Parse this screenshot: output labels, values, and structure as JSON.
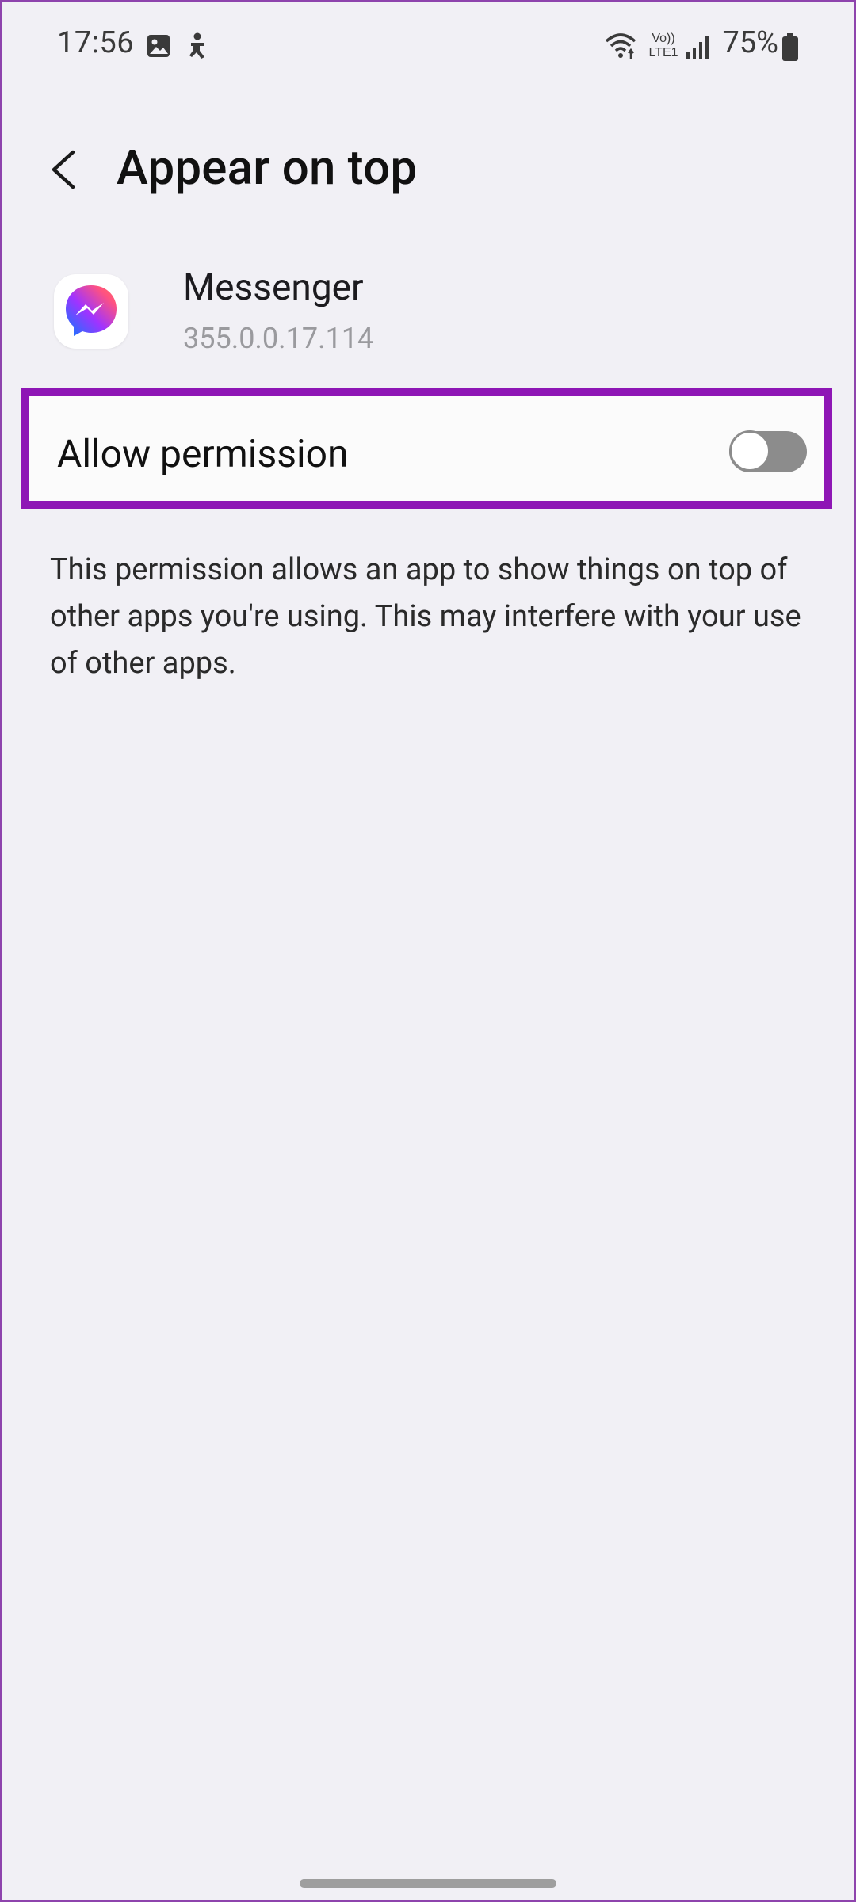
{
  "status_bar": {
    "time": "17:56",
    "battery_percent": "75%",
    "icons": [
      "gallery-icon",
      "accessibility-icon",
      "wifi-icon",
      "volte-lte-icon",
      "signal-icon",
      "battery-icon"
    ],
    "volte_label_top": "Vo))",
    "volte_label_bottom": "LTE1"
  },
  "header": {
    "title": "Appear on top",
    "back_icon": "chevron-left-icon"
  },
  "app": {
    "name": "Messenger",
    "version": "355.0.0.17.114",
    "icon": "messenger-icon"
  },
  "permission": {
    "label": "Allow permission",
    "enabled": false
  },
  "description": "This permission allows an app to show things on top of other apps you're using. This may interfere with your use of other apps.",
  "colors": {
    "background": "#f1f0f5",
    "highlight_border": "#8e16b5",
    "toggle_off": "#8c8c8c"
  }
}
